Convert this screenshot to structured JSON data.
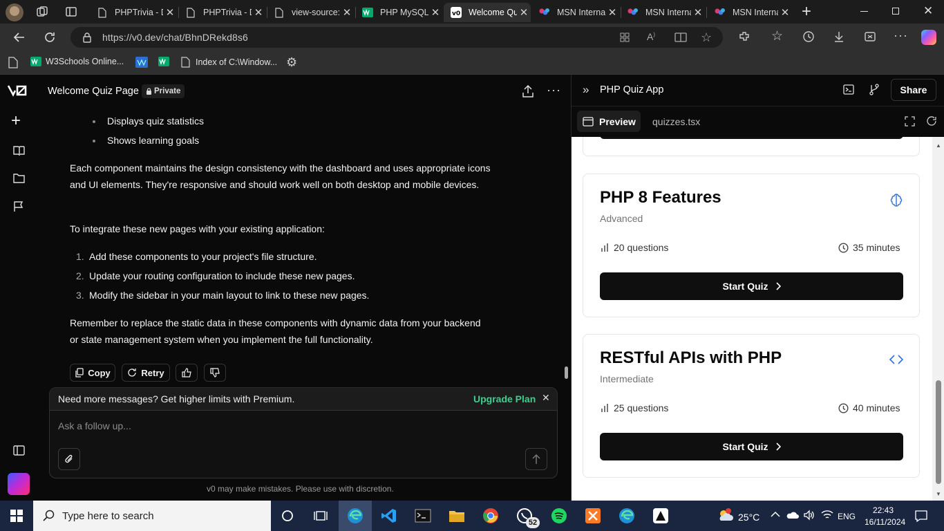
{
  "browser": {
    "tabs": [
      {
        "label": "PHPTrivia - D",
        "icon": "page-icon"
      },
      {
        "label": "PHPTrivia - D",
        "icon": "page-icon"
      },
      {
        "label": "view-source:",
        "icon": "page-icon"
      },
      {
        "label": "PHP MySQL",
        "icon": "w3schools-icon"
      },
      {
        "label": "Welcome Qu",
        "icon": "v0-icon",
        "active": true
      },
      {
        "label": "MSN Interna",
        "icon": "msn-icon"
      },
      {
        "label": "MSN Interna",
        "icon": "msn-icon"
      },
      {
        "label": "MSN Interna",
        "icon": "msn-icon"
      }
    ],
    "url": "https://v0.dev/chat/BhnDRekd8s6",
    "bookmarks": [
      {
        "label": "W3Schools Online..."
      },
      {
        "label": ""
      },
      {
        "label": ""
      },
      {
        "label": "Index of C:\\Window..."
      }
    ]
  },
  "chat": {
    "title": "Welcome Quiz Page",
    "privacy_badge": "Private",
    "bullets": [
      "Displays quiz statistics",
      "Shows learning goals"
    ],
    "paragraph1": "Each component maintains the design consistency with the dashboard and uses appropriate icons and UI elements. They're responsive and should work well on both desktop and mobile devices.",
    "paragraph2": "To integrate these new pages with your existing application:",
    "steps": [
      {
        "num": "1.",
        "text": "Add these components to your project's file structure."
      },
      {
        "num": "2.",
        "text": "Update your routing configuration to include these new pages."
      },
      {
        "num": "3.",
        "text": "Modify the sidebar in your main layout to link to these new pages."
      }
    ],
    "paragraph3": "Remember to replace the static data in these components with dynamic data from your backend or state management system when you implement the full functionality.",
    "actions": {
      "copy": "Copy",
      "retry": "Retry"
    },
    "upgrade_text": "Need more messages? Get higher limits with Premium.",
    "upgrade_link": "Upgrade Plan",
    "input_placeholder": "Ask a follow up...",
    "disclaimer": "v0 may make mistakes. Please use with discretion."
  },
  "preview": {
    "title": "PHP Quiz App",
    "share": "Share",
    "tabs": {
      "preview": "Preview",
      "file": "quizzes.tsx"
    },
    "quizzes": [
      {
        "title": "PHP 8 Features",
        "level": "Advanced",
        "questions": "20 questions",
        "duration": "35 minutes",
        "button": "Start Quiz",
        "icon": "brain-icon"
      },
      {
        "title": "RESTful APIs with PHP",
        "level": "Intermediate",
        "questions": "25 questions",
        "duration": "40 minutes",
        "button": "Start Quiz",
        "icon": "code-icon"
      }
    ]
  },
  "taskbar": {
    "search_placeholder": "Type here to search",
    "whatsapp_badge": "52",
    "weather": "25°C",
    "language": "ENG",
    "time": "22:43",
    "date": "16/11/2024"
  },
  "colors": {
    "accent_green": "#3ecf8e",
    "dark": "#0a0a0a",
    "taskbar": "#1a2540"
  }
}
